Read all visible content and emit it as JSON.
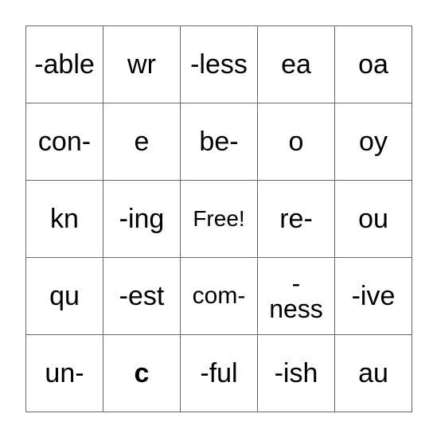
{
  "board": {
    "rows": [
      [
        "-able",
        "wr",
        "-less",
        "ea",
        "oa"
      ],
      [
        "con-",
        "e",
        "be-",
        "o",
        "oy"
      ],
      [
        "kn",
        "-ing",
        "Free!",
        "re-",
        "ou"
      ],
      [
        "qu",
        "-est",
        "com-",
        "-ness",
        "-ive"
      ],
      [
        "un-",
        "c",
        "-ful",
        "-ish",
        "au"
      ]
    ]
  }
}
